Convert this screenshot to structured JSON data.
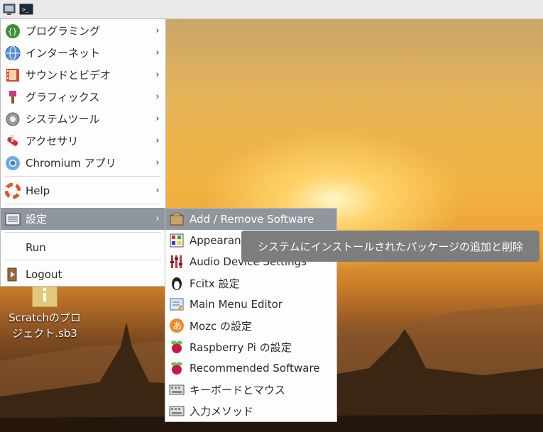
{
  "panel": {
    "menu_icon": "raspberry-menu-icon",
    "terminal_icon": "terminal-icon"
  },
  "main_menu": {
    "items": [
      {
        "label": "プログラミング",
        "icon": "programming-icon",
        "submenu": true
      },
      {
        "label": "インターネット",
        "icon": "globe-icon",
        "submenu": true
      },
      {
        "label": "サウンドとビデオ",
        "icon": "film-icon",
        "submenu": true
      },
      {
        "label": "グラフィックス",
        "icon": "paintbrush-icon",
        "submenu": true
      },
      {
        "label": "システムツール",
        "icon": "gear-icon",
        "submenu": true
      },
      {
        "label": "アクセサリ",
        "icon": "swiss-knife-icon",
        "submenu": true
      },
      {
        "label": "Chromium アプリ",
        "icon": "chromium-icon",
        "submenu": true
      },
      {
        "label": "Help",
        "icon": "lifebuoy-icon",
        "submenu": true
      },
      {
        "label": "設定",
        "icon": "preferences-icon",
        "submenu": true,
        "selected": true
      },
      {
        "label": "Run",
        "icon": "",
        "submenu": false
      },
      {
        "label": "Logout",
        "icon": "logout-icon",
        "submenu": false
      }
    ],
    "arrow": "›"
  },
  "sub_menu": {
    "items": [
      {
        "label": "Add / Remove Software",
        "icon": "package-icon",
        "selected": true
      },
      {
        "label": "Appearance Settings",
        "icon": "appearance-icon"
      },
      {
        "label": "Audio Device Settings",
        "icon": "audio-mixer-icon"
      },
      {
        "label": "Fcitx 設定",
        "icon": "penguin-icon"
      },
      {
        "label": "Main Menu Editor",
        "icon": "menu-editor-icon"
      },
      {
        "label": "Mozc の設定",
        "icon": "mozc-icon"
      },
      {
        "label": "Raspberry Pi の設定",
        "icon": "raspberry-icon"
      },
      {
        "label": "Recommended Software",
        "icon": "raspberry-icon"
      },
      {
        "label": "キーボードとマウス",
        "icon": "keyboard-icon"
      },
      {
        "label": "入力メソッド",
        "icon": "keyboard-icon"
      }
    ]
  },
  "tooltip": {
    "text": "システムにインストールされたパッケージの追加と削除"
  },
  "desktop_icon": {
    "label_line1": "Scratchのプロ",
    "label_line2": "ジェクト.sb3"
  },
  "colors": {
    "highlight": "#8f969d",
    "tooltip_bg": "#7d7d7d",
    "menu_bg": "#fdfdfd"
  }
}
